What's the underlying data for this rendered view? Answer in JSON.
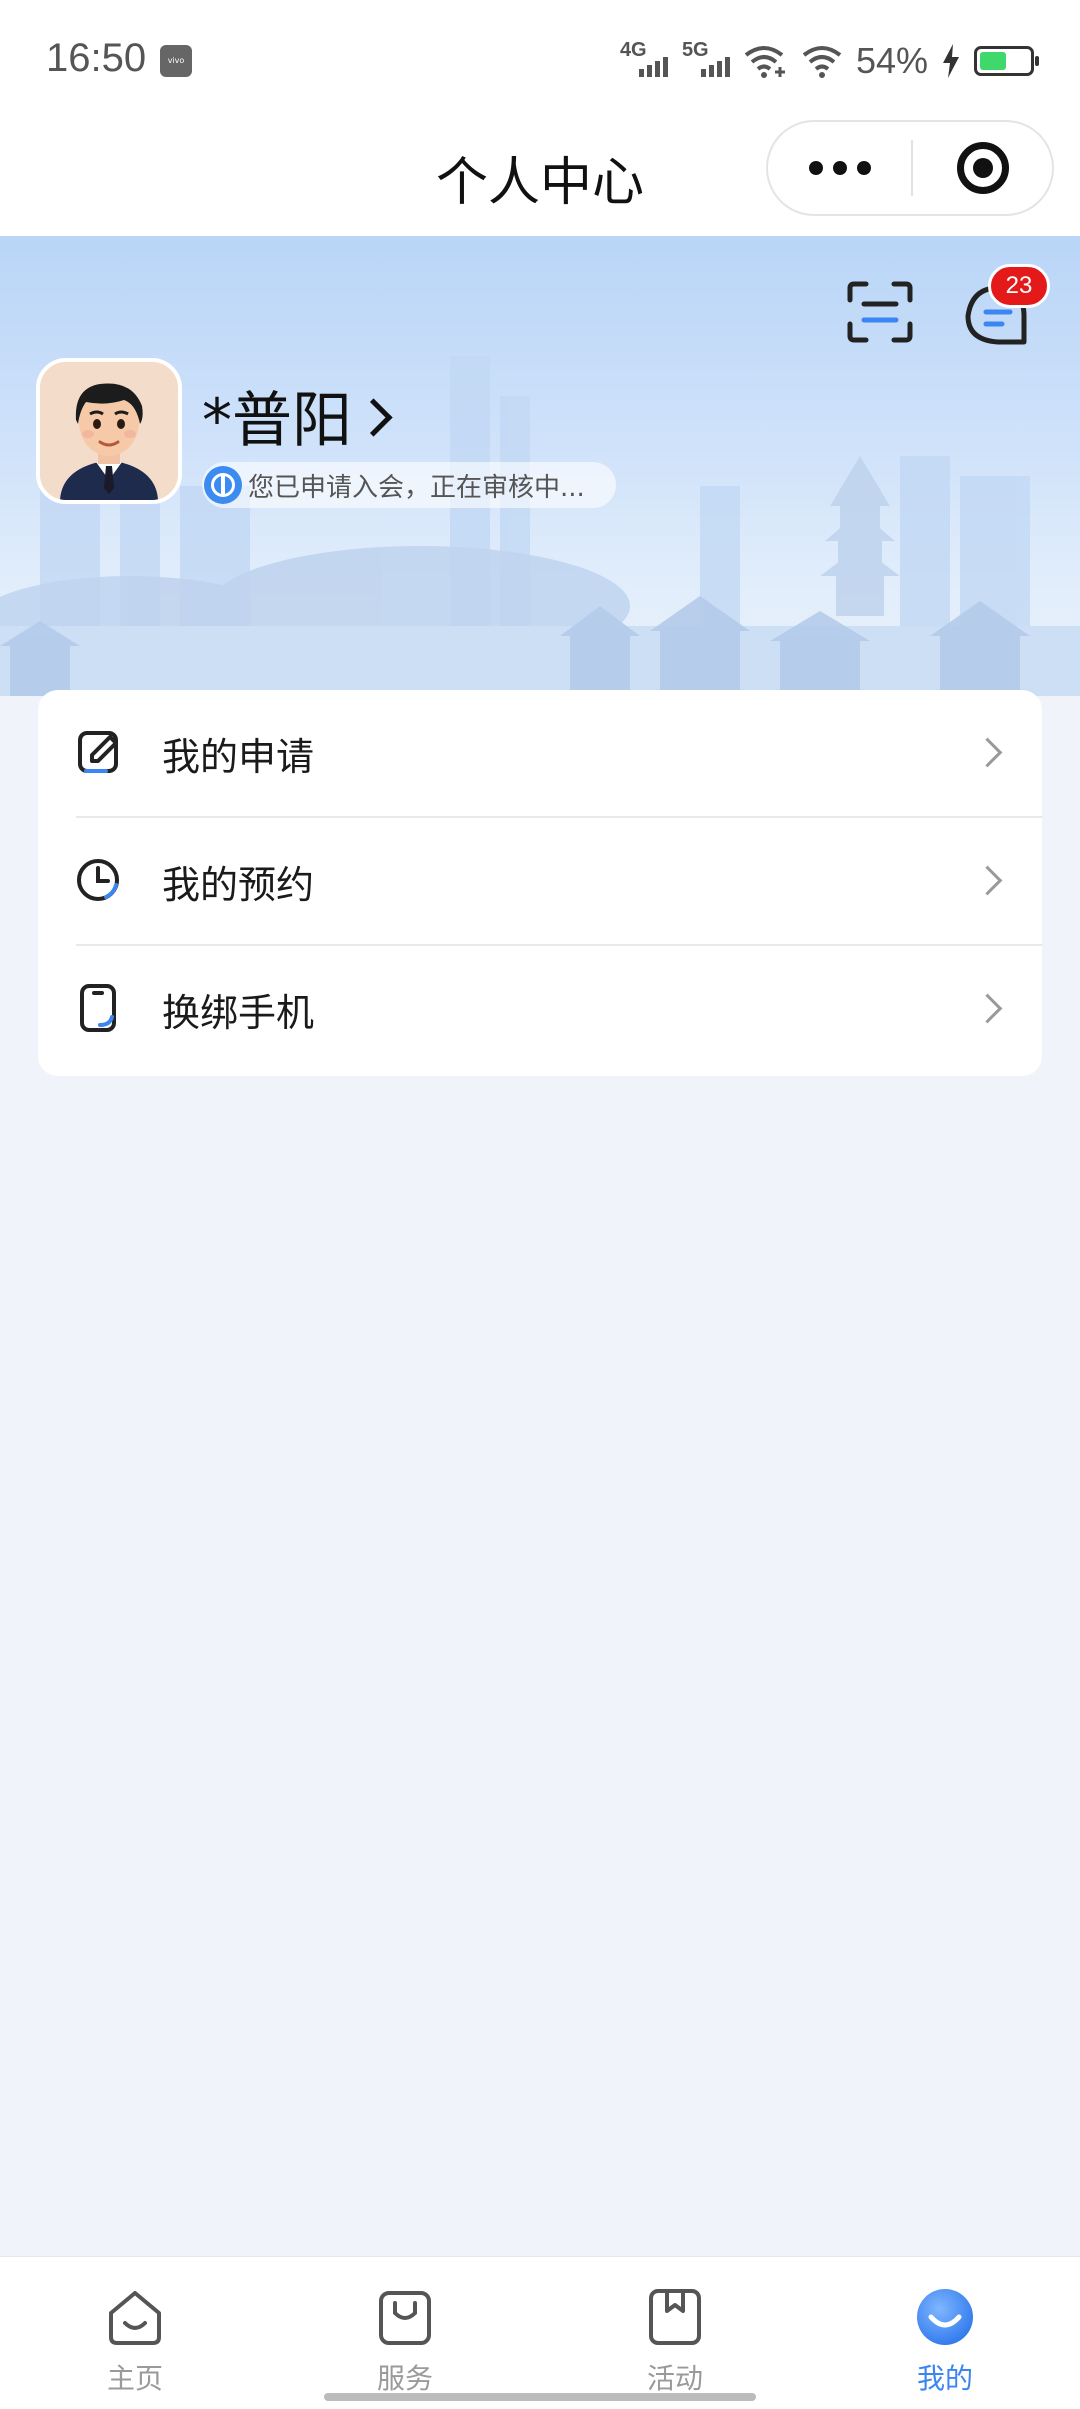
{
  "status_bar": {
    "time": "16:50",
    "carrier_badge": "vivo",
    "signal_1": "4G",
    "signal_2": "5G",
    "battery_text": "54%",
    "battery_level": 0.54,
    "icons": [
      "signal-4g-icon",
      "signal-5g-icon",
      "wifi-plus-icon",
      "wifi-icon",
      "charging-icon",
      "battery-icon"
    ]
  },
  "header": {
    "title": "个人中心",
    "capsule": {
      "more_icon": "more-dots-icon",
      "close_icon": "target-circle-icon"
    }
  },
  "hero": {
    "scan_icon": "scan-icon",
    "message_icon": "message-icon",
    "unread_count": "23",
    "user": {
      "name": "*普阳",
      "avatar": "avatar-cartoon-man",
      "status_icon": "union-logo-icon",
      "status_text": "您已申请入会，正在审核中..."
    }
  },
  "menu": {
    "items": [
      {
        "label": "我的申请",
        "icon": "edit-document-icon"
      },
      {
        "label": "我的预约",
        "icon": "clock-icon"
      },
      {
        "label": "换绑手机",
        "icon": "phone-icon"
      }
    ]
  },
  "tabs": {
    "items": [
      {
        "label": "主页",
        "icon": "home-icon",
        "active": false
      },
      {
        "label": "服务",
        "icon": "bag-icon",
        "active": false
      },
      {
        "label": "活动",
        "icon": "bookmark-icon",
        "active": false
      },
      {
        "label": "我的",
        "icon": "profile-smile-icon",
        "active": true
      }
    ]
  },
  "colors": {
    "accent": "#3b86f0",
    "badge": "#e41a1a",
    "hero_top": "#b9d5f7",
    "page_bg": "#f0f4fa"
  }
}
